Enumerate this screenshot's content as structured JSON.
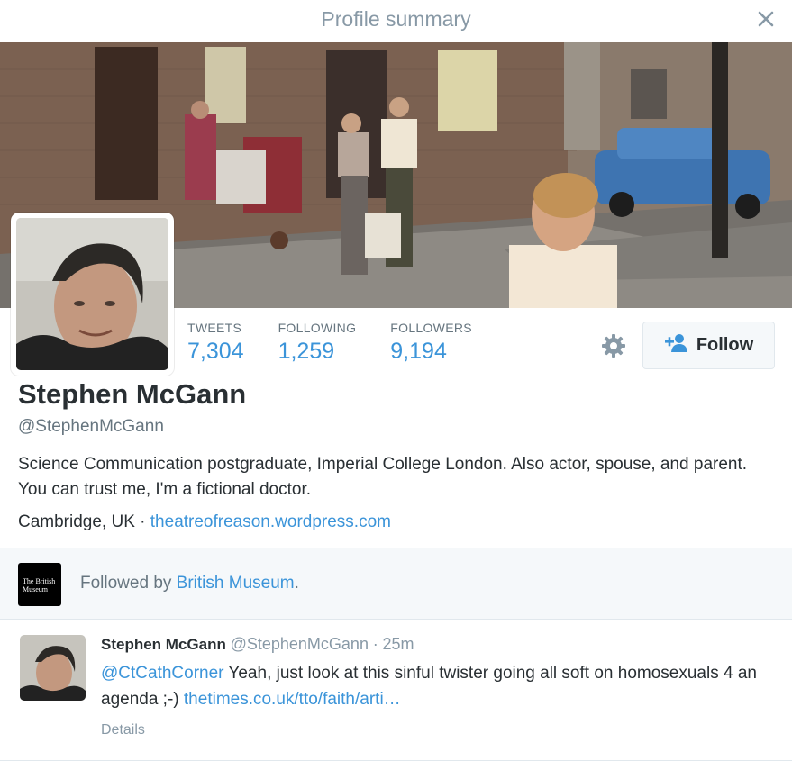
{
  "modal": {
    "title": "Profile summary",
    "close_icon": "close-icon"
  },
  "profile": {
    "name": "Stephen McGann",
    "handle": "@StephenMcGann",
    "bio": "Science Communication postgraduate, Imperial College London. Also actor, spouse, and parent. You can trust me, I'm a fictional doctor.",
    "location": "Cambridge, UK",
    "separator": "·",
    "website": "theatreofreason.wordpress.com"
  },
  "stats": [
    {
      "label": "TWEETS",
      "value": "7,304"
    },
    {
      "label": "FOLLOWING",
      "value": "1,259"
    },
    {
      "label": "FOLLOWERS",
      "value": "9,194"
    }
  ],
  "actions": {
    "settings_icon": "gear-icon",
    "follow_icon": "add-user-icon",
    "follow_label": "Follow"
  },
  "followed_by": {
    "logo_text": "The British Museum",
    "prefix": "Followed by",
    "account": "British Museum",
    "suffix": "."
  },
  "tweet": {
    "name": "Stephen McGann",
    "handle": "@StephenMcGann",
    "separator": "·",
    "time": "25m",
    "mention": "@CtCathCorner",
    "text": " Yeah, just look at this sinful twister going all soft on homosexuals 4 an agenda ;-) ",
    "link": "thetimes.co.uk/tto/faith/arti…",
    "details_label": "Details"
  },
  "colors": {
    "accent": "#3b94d9",
    "muted": "#66757f",
    "text": "#292f33",
    "panel": "#f5f8fa"
  }
}
